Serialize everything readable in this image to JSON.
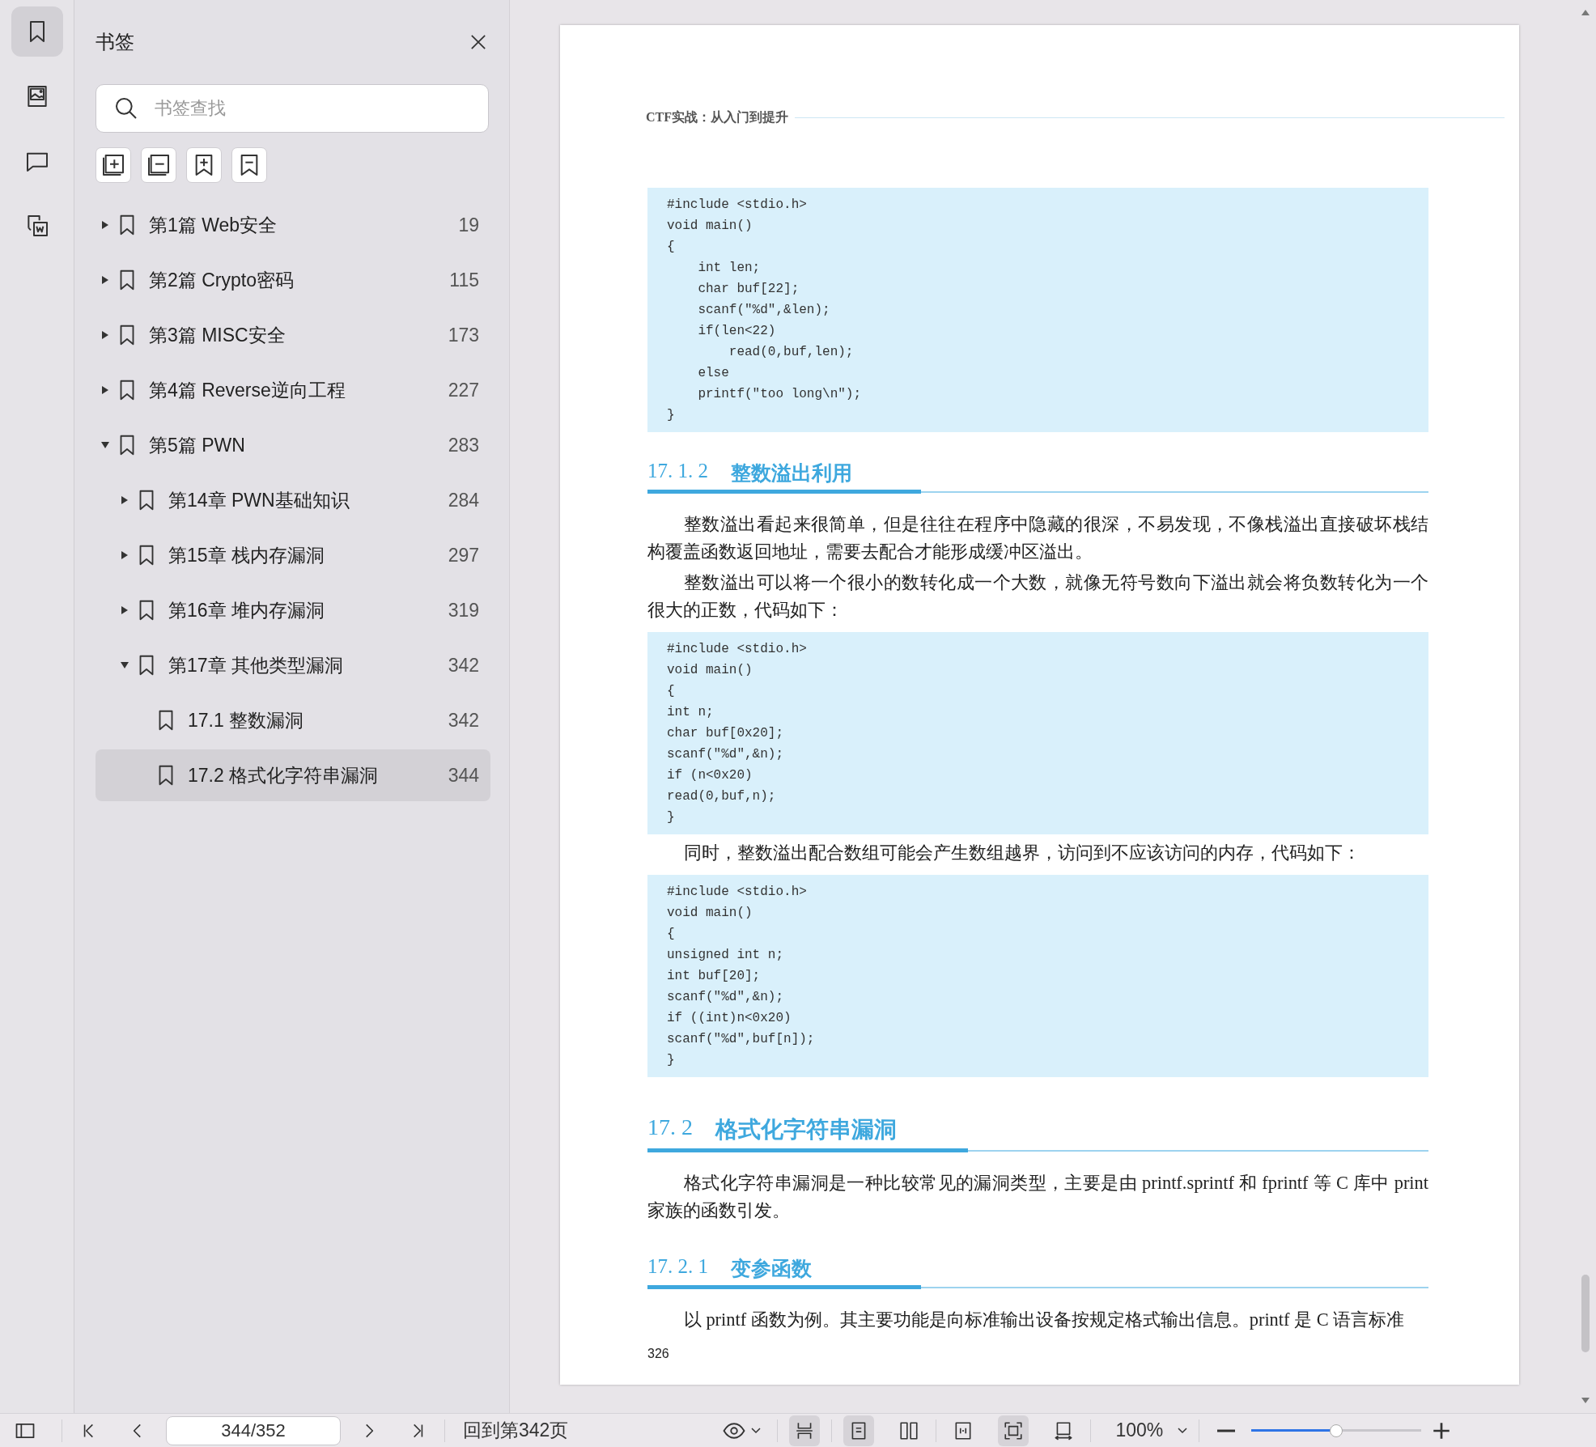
{
  "rail": {
    "items": [
      {
        "kind": "bookmark",
        "selected": true
      },
      {
        "kind": "image",
        "selected": false
      },
      {
        "kind": "comment",
        "selected": false
      },
      {
        "kind": "convert",
        "selected": false
      }
    ]
  },
  "sidebar": {
    "title": "书签",
    "search": {
      "placeholder": "书签查找"
    },
    "tools": [
      {
        "kind": "expand-all"
      },
      {
        "kind": "collapse-all"
      },
      {
        "kind": "add-bookmark"
      },
      {
        "kind": "remove-bookmark"
      }
    ],
    "bookmarks": [
      {
        "label": "第1篇 Web安全",
        "page": "19",
        "expanded": false,
        "selected": false
      },
      {
        "label": "第2篇 Crypto密码",
        "page": "115",
        "expanded": false,
        "selected": false
      },
      {
        "label": "第3篇 MISC安全",
        "page": "173",
        "expanded": false,
        "selected": false
      },
      {
        "label": "第4篇 Reverse逆向工程",
        "page": "227",
        "expanded": false,
        "selected": false
      },
      {
        "label": "第5篇 PWN",
        "page": "283",
        "expanded": true,
        "selected": false,
        "children": [
          {
            "label": "第14章 PWN基础知识",
            "page": "284",
            "expanded": false,
            "selected": false
          },
          {
            "label": "第15章 栈内存漏洞",
            "page": "297",
            "expanded": false,
            "selected": false
          },
          {
            "label": "第16章 堆内存漏洞",
            "page": "319",
            "expanded": false,
            "selected": false
          },
          {
            "label": "第17章 其他类型漏洞",
            "page": "342",
            "expanded": true,
            "selected": false,
            "children": [
              {
                "label": "17.1 整数漏洞",
                "page": "342",
                "selected": false
              },
              {
                "label": "17.2 格式化字符串漏洞",
                "page": "344",
                "selected": true
              }
            ]
          }
        ]
      }
    ]
  },
  "document": {
    "header": "CTF实战：从入门到提升",
    "blocks": [
      {
        "kind": "code",
        "lines": [
          "#include <stdio.h>",
          "void main()",
          "{",
          "    int len;",
          "    char buf[22];",
          "    scanf(\"%d\",&len);",
          "    if(len<22)",
          "        read(0,buf,len);",
          "    else",
          "    printf(\"too long\\n\");",
          "}"
        ]
      },
      {
        "kind": "subsection",
        "number": "17. 1. 2",
        "title": "整数溢出利用"
      },
      {
        "kind": "paragraph",
        "text": "整数溢出看起来很简单，但是往往在程序中隐藏的很深，不易发现，不像栈溢出直接破坏栈结构覆盖函数返回地址，需要去配合才能形成缓冲区溢出。"
      },
      {
        "kind": "paragraph",
        "text": "整数溢出可以将一个很小的数转化成一个大数，就像无符号数向下溢出就会将负数转化为一个很大的正数，代码如下："
      },
      {
        "kind": "code",
        "lines": [
          "#include <stdio.h>",
          "void main()",
          "{",
          "int n;",
          "char buf[0x20];",
          "scanf(\"%d\",&n);",
          "if (n<0x20)",
          "read(0,buf,n);",
          "}"
        ]
      },
      {
        "kind": "paragraph",
        "text": "同时，整数溢出配合数组可能会产生数组越界，访问到不应该访问的内存，代码如下："
      },
      {
        "kind": "code",
        "lines": [
          "#include <stdio.h>",
          "void main()",
          "{",
          "unsigned int n;",
          "int buf[20];",
          "scanf(\"%d\",&n);",
          "if ((int)n<0x20)",
          "scanf(\"%d\",buf[n]);",
          "}"
        ]
      },
      {
        "kind": "section",
        "number": "17. 2",
        "title": "格式化字符串漏洞"
      },
      {
        "kind": "paragraph",
        "text": "格式化字符串漏洞是一种比较常见的漏洞类型，主要是由 printf.sprintf 和 fprintf 等 C 库中 print 家族的函数引发。"
      },
      {
        "kind": "subsection",
        "number": "17. 2. 1",
        "title": "变参函数"
      },
      {
        "kind": "paragraph",
        "text": "以 printf 函数为例。其主要功能是向标准输出设备按规定格式输出信息。printf 是 C 语言标准"
      }
    ],
    "page_number": "326"
  },
  "toolbar": {
    "page_field": "344/352",
    "goto": "回到第342页",
    "views": [
      {
        "kind": "continuous",
        "selected": true
      },
      {
        "kind": "single",
        "selected": true
      },
      {
        "kind": "double",
        "selected": false
      },
      {
        "kind": "fit-width",
        "selected": false
      },
      {
        "kind": "fit-page",
        "selected": true
      },
      {
        "kind": "rotate",
        "selected": false
      }
    ],
    "zoom": "100%",
    "zoom_slider": {
      "level": 0.5
    }
  }
}
